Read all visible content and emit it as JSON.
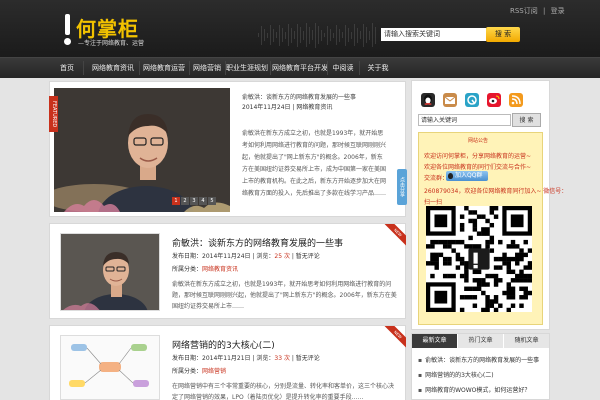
{
  "header": {
    "logo_title": "何掌柜",
    "logo_subtitle": "—专注于网络教育、运营",
    "top_links": [
      "RSS订阅",
      "|",
      "登录"
    ],
    "search_input_value": "请输入搜索关键词",
    "search_button": "搜 索"
  },
  "nav": {
    "items": [
      "首页",
      "网络教育资讯",
      "网络教育运营",
      "网络营销",
      "职业生涯规划",
      "网络教育平台开发",
      "中阅读",
      "关于我"
    ]
  },
  "featured": {
    "ribbon": "FEATURED",
    "title": "俞敏洪：谈新东方的网络教育发展的一些事",
    "meta": "2014年11月24日 | 网络教育资讯",
    "excerpt": "俞敏洪在新东方成立之初，也就是1993年，就开始思考如何利用网络进行教育的问题，那时候互联网刚刚兴起，他就提出了\"网上新东方\"的概念。2006年，新东方在美国纽约证券交易所上市，成为中国第一家在美国上市的教育机构。在此之后，新东方开始逐步加大在网络教育方面的投入，先后推出了多款在线学习产品……",
    "dots": [
      "1",
      "2",
      "3",
      "4",
      "5"
    ],
    "share_tab": "点击分享"
  },
  "posts": [
    {
      "title": "俞敏洪：谈新东方的网络教育发展的一些事",
      "date": "发布日期：2014年11月24日",
      "views_label": "浏览：",
      "views": "25 次",
      "comments": "暂无评论",
      "category_label": "所属分类：",
      "category": "网络教育资讯",
      "excerpt": "俞敏洪在新东方成立之初，也就是1993年，就开始思考如何利用网络进行教育的问题，那时候互联网刚刚兴起，他就提出了\"网上新东方\"的概念。2006年，新东方在美国纽约证券交易所上市……",
      "new_badge": "NEW"
    },
    {
      "title": "网络营销的的3大核心(二)",
      "date": "发布日期：2014年11月21日",
      "views_label": "浏览：",
      "views": "33 次",
      "comments": "暂无评论",
      "category_label": "所属分类：",
      "category": "网络营销",
      "excerpt": "在网络营销中有三个非常重要的核心，分别是流量、转化率和客单价，这三个核心决定了网络营销的效果，LPO（着陆页优化）是提升转化率的重要手段……",
      "new_badge": "NEW"
    }
  ],
  "sidebar": {
    "social_icons": [
      "qq-icon",
      "email-icon",
      "tqq-icon",
      "weibo-icon",
      "rss-icon"
    ],
    "search_input_value": "请输入关键词",
    "search_button": "搜 索",
    "notice_title": "网站公告",
    "notice_lines": [
      "欢迎访问何掌柜，分享网络教育的运营~",
      "欢迎各位网络教育的同行们交流与合作~",
      "交流群：",
      "260879034，欢迎各位网络教育同行加入~ 微信号：",
      "扫一扫"
    ],
    "qq_button": "加入QQ群",
    "tabs": [
      "最新文章",
      "热门文章",
      "随机文章"
    ],
    "tab_items": [
      "俞敏洪：谈新东方的网络教育发展的一些事",
      "网络营销的的3大核心(二)",
      "网络教育的WOWO模式，如何运营好？"
    ]
  },
  "colors": {
    "accent": "#c8311c",
    "logo": "#f2c200",
    "header_bg": "#222222",
    "notice_bg": "#fff3b8"
  }
}
